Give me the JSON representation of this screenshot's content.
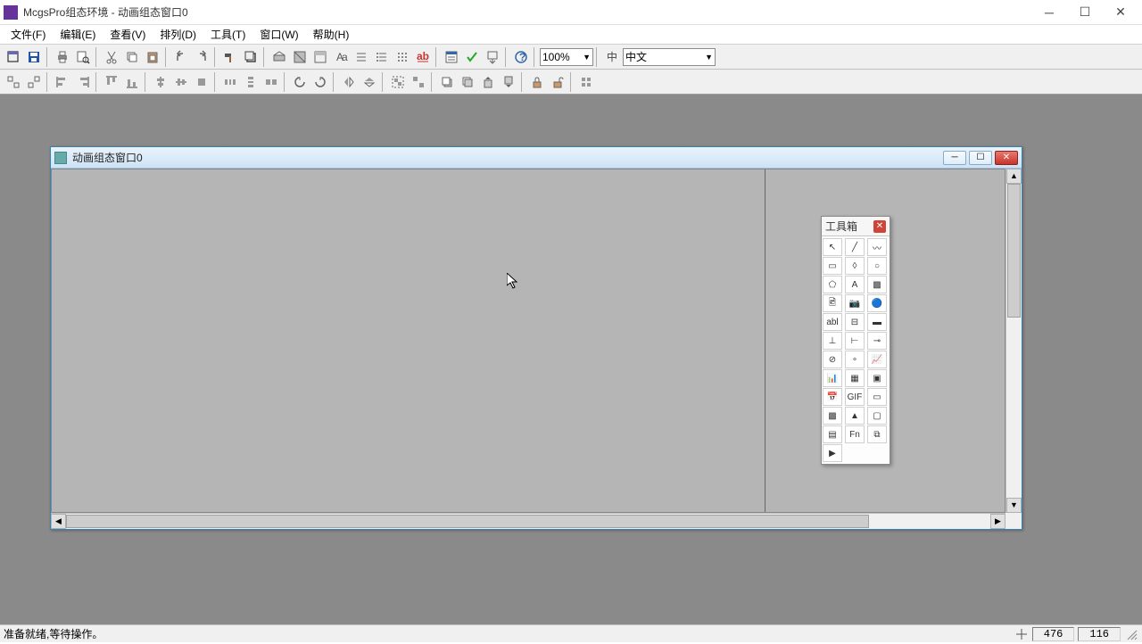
{
  "app": {
    "title": "McgsPro组态环境 - 动画组态窗口0"
  },
  "menus": {
    "file": "文件(F)",
    "edit": "编辑(E)",
    "view": "查看(V)",
    "arrange": "排列(D)",
    "tools": "工具(T)",
    "window": "窗口(W)",
    "help": "帮助(H)"
  },
  "toolbar": {
    "zoom": "100%",
    "language": "中文"
  },
  "child": {
    "title": "动画组态窗口0"
  },
  "toolbox": {
    "title": "工具箱",
    "tools": [
      "↖",
      "╱",
      "〰",
      "▭",
      "◊",
      "○",
      "⬠",
      "A",
      "▩",
      "🖻",
      "📷",
      "🔵",
      "abl",
      "⊟",
      "▬",
      "⊥",
      "⊢",
      "⊸",
      "⊘",
      "∘",
      "📈",
      "📊",
      "▦",
      "▣",
      "📅",
      "GIF",
      "▭",
      "▩",
      "▲",
      "▢",
      "▤",
      "Fn",
      "⧉",
      "▶"
    ]
  },
  "status": {
    "message": "准备就绪,等待操作。",
    "coord_x": "476",
    "coord_y": "116"
  }
}
